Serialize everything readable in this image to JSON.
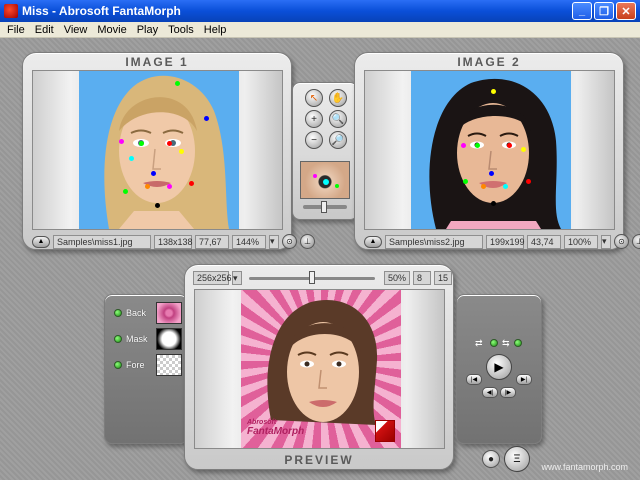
{
  "window": {
    "title": "Miss - Abrosoft FantaMorph"
  },
  "menu": [
    "File",
    "Edit",
    "View",
    "Movie",
    "Play",
    "Tools",
    "Help"
  ],
  "image1": {
    "title": "IMAGE 1",
    "file": "Samples\\miss1.jpg",
    "size": "138x138",
    "coords": "77,67",
    "zoom": "144%"
  },
  "image2": {
    "title": "IMAGE 2",
    "file": "Samples\\miss2.jpg",
    "size": "199x199",
    "coords": "43,74",
    "zoom": "100%"
  },
  "preview": {
    "title": "PREVIEW",
    "resolution": "256x256",
    "percent": "50%",
    "frame": "8",
    "total": "15",
    "slider_fraction": 0.5,
    "logo_line1": "Abrosoft",
    "logo_line2": "FantaMorph"
  },
  "layers": [
    {
      "label": "Back"
    },
    {
      "label": "Mask"
    },
    {
      "label": "Fore"
    }
  ],
  "footer": {
    "url": "www.fantamorph.com"
  },
  "colors": {
    "sky": "#5aaef0",
    "preview_pink": "#e0609a"
  }
}
